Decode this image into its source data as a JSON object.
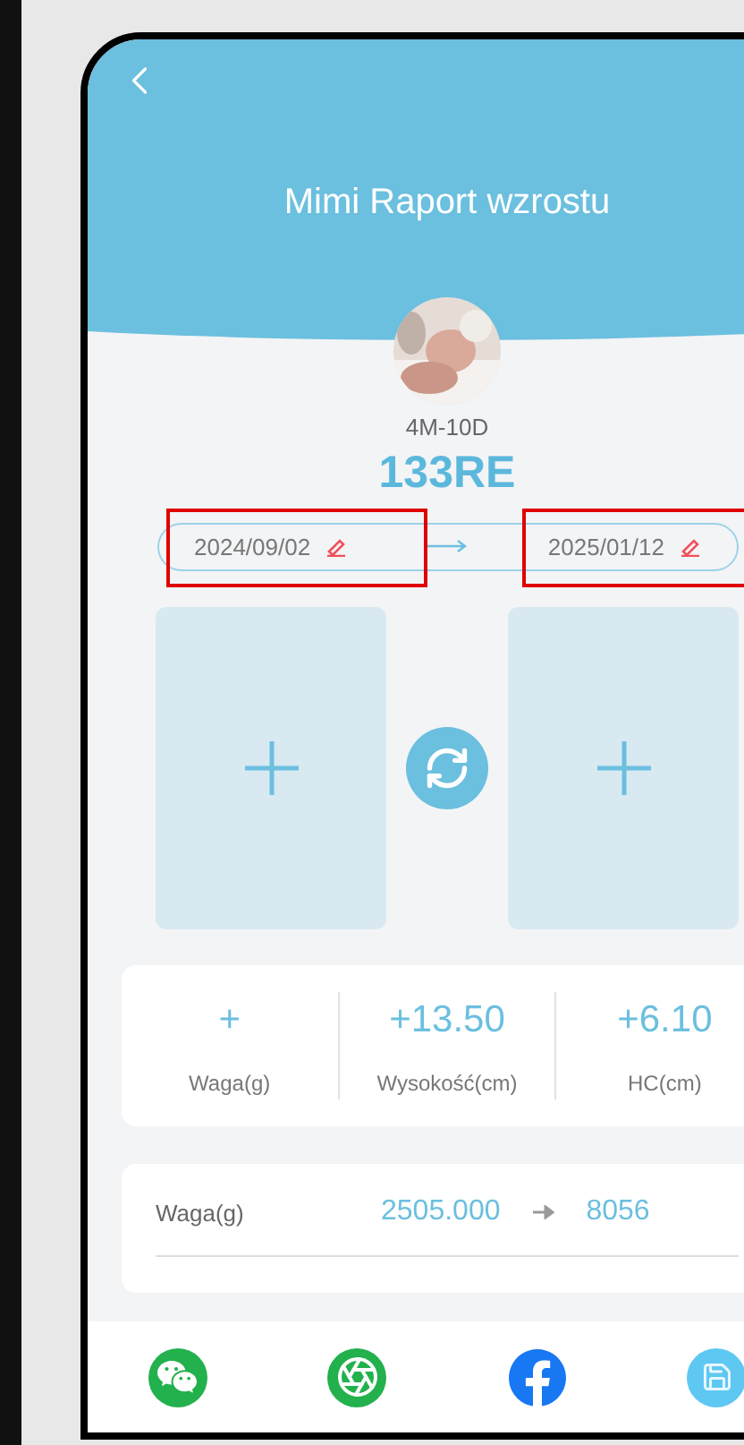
{
  "header": {
    "title": "Mimi Raport wzrostu"
  },
  "baby": {
    "age": "4M-10D",
    "name": "133RE"
  },
  "dates": [
    {
      "value": "2024/09/02",
      "highlighted": true
    },
    {
      "value": "2025/01/12",
      "highlighted": true
    }
  ],
  "summary": [
    {
      "value": "+",
      "label": "Waga(g)"
    },
    {
      "value": "+13.50",
      "label": "Wysokość(cm)"
    },
    {
      "value": "+6.10",
      "label": "HC(cm)"
    }
  ],
  "measurements": [
    {
      "label": "Waga(g)",
      "from": "2505.000",
      "to": "8056"
    }
  ],
  "share_buttons": [
    {
      "kind": "wechat"
    },
    {
      "kind": "moments"
    },
    {
      "kind": "facebook"
    },
    {
      "kind": "save"
    }
  ]
}
